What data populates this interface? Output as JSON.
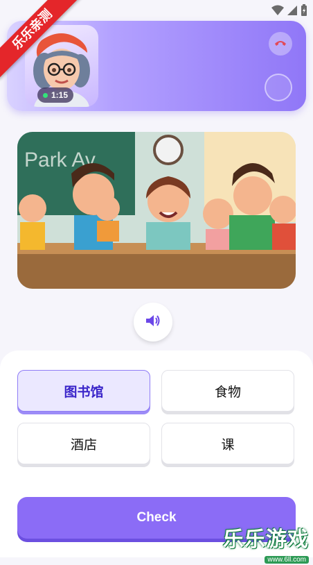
{
  "status_bar": {
    "icons": [
      "wifi-icon",
      "signal-icon",
      "battery-icon"
    ]
  },
  "watermark": {
    "ribbon_text": "乐乐亲测",
    "site_name": "乐乐游戏",
    "site_url": "www.6ll.com"
  },
  "call": {
    "timer": "1:15",
    "hangup_icon": "phone-hangup-icon",
    "mic_icon": "mic-icon"
  },
  "scene": {
    "description_icon": "classroom-illustration",
    "board_text": "Park Av"
  },
  "audio": {
    "icon": "speaker-icon"
  },
  "options": [
    {
      "label": "图书馆",
      "selected": true
    },
    {
      "label": "食物",
      "selected": false
    },
    {
      "label": "酒店",
      "selected": false
    },
    {
      "label": "课",
      "selected": false
    }
  ],
  "check_button": {
    "label": "Check"
  },
  "colors": {
    "accent": "#8b6cf6",
    "selected_text": "#3a25c9",
    "selected_bg": "#ebe8ff"
  }
}
